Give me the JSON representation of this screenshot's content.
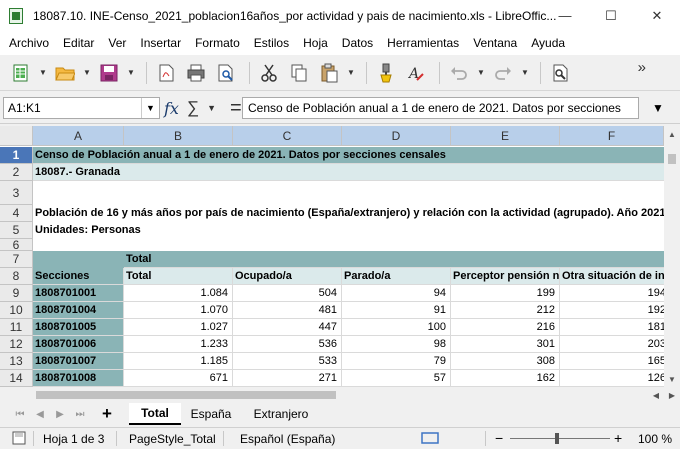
{
  "window": {
    "title": "18087.10. INE-Censo_2021_poblacion16años_por actividad y pais de nacimiento.xls - LibreOffic...",
    "min_glyph": "—",
    "max_glyph": "☐",
    "close_glyph": "✕"
  },
  "menu": [
    "Archivo",
    "Editar",
    "Ver",
    "Insertar",
    "Formato",
    "Estilos",
    "Hoja",
    "Datos",
    "Herramientas",
    "Ventana",
    "Ayuda"
  ],
  "formula_bar": {
    "name_box": "A1:K1",
    "content": "Censo de Población anual a 1 de enero de 2021. Datos por secciones"
  },
  "columns": [
    "A",
    "B",
    "C",
    "D",
    "E",
    "F"
  ],
  "rows": {
    "r1": {
      "num": "1",
      "a": "Censo de Población anual a 1 de enero de 2021. Datos por secciones censales"
    },
    "r2": {
      "num": "2",
      "a": "18087.- Granada"
    },
    "r3": {
      "num": "3"
    },
    "r4": {
      "num": "4",
      "a": "Población de 16 y más años por país de nacimiento (España/extranjero) y relación con la actividad (agrupado). Año 2021"
    },
    "r5": {
      "num": "5",
      "a": "Unidades: Personas"
    },
    "r6": {
      "num": "6"
    },
    "r7": {
      "num": "7",
      "b": "Total"
    },
    "r8": {
      "num": "8",
      "a": "Secciones",
      "b": "Total",
      "c": "Ocupado/a",
      "d": "Parado/a",
      "e": "Perceptor pensión no contributiva",
      "f": "Otra situación de inactividad"
    }
  },
  "data_rows": [
    {
      "num": "9",
      "seccion": "1808701001",
      "total": "1.084",
      "ocupado": "504",
      "parado": "94",
      "pension": "199",
      "otra": "194"
    },
    {
      "num": "10",
      "seccion": "1808701004",
      "total": "1.070",
      "ocupado": "481",
      "parado": "91",
      "pension": "212",
      "otra": "192"
    },
    {
      "num": "11",
      "seccion": "1808701005",
      "total": "1.027",
      "ocupado": "447",
      "parado": "100",
      "pension": "216",
      "otra": "181"
    },
    {
      "num": "12",
      "seccion": "1808701006",
      "total": "1.233",
      "ocupado": "536",
      "parado": "98",
      "pension": "301",
      "otra": "203"
    },
    {
      "num": "13",
      "seccion": "1808701007",
      "total": "1.185",
      "ocupado": "533",
      "parado": "79",
      "pension": "308",
      "otra": "165"
    },
    {
      "num": "14",
      "seccion": "1808701008",
      "total": "671",
      "ocupado": "271",
      "parado": "57",
      "pension": "162",
      "otra": "126"
    }
  ],
  "sheet_tabs": [
    "Total",
    "España",
    "Extranjero"
  ],
  "status": {
    "sheet": "Hoja 1 de 3",
    "page_style": "PageStyle_Total",
    "language": "Español (España)",
    "zoom": "100 %",
    "zoom_minus": "−",
    "zoom_plus": "+"
  },
  "colors": {
    "header_band": "#8ab4b6",
    "light_band": "#dbeaeb",
    "selected_row": "#4a76b8"
  }
}
